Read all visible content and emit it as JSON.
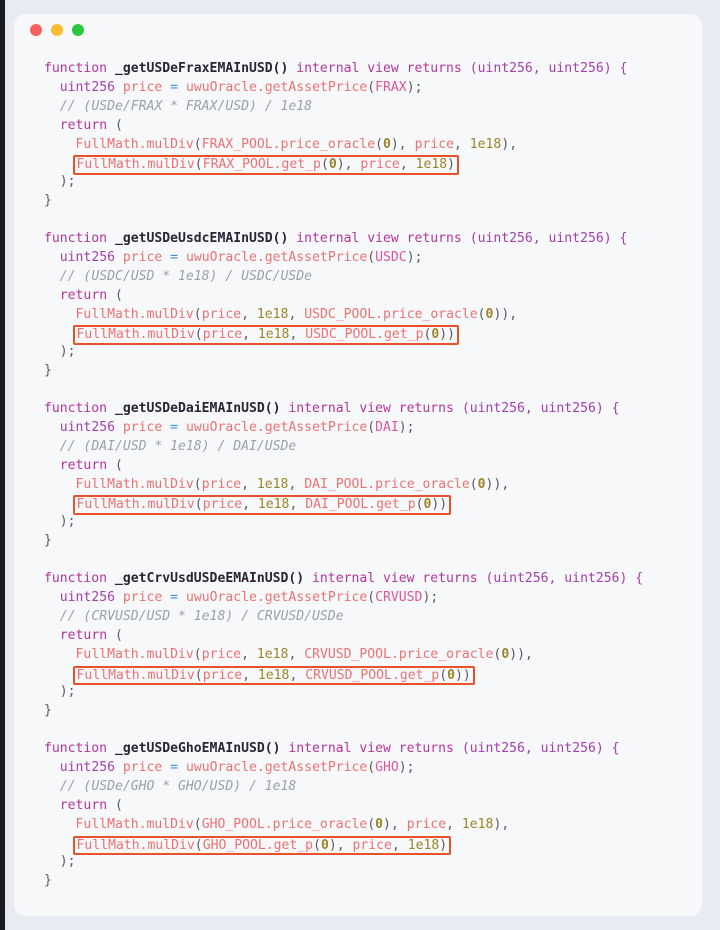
{
  "window": {
    "traffic_lights": [
      {
        "name": "close",
        "color": "#f9605a"
      },
      {
        "name": "minimize",
        "color": "#fbbc2e"
      },
      {
        "name": "maximize",
        "color": "#2ac840"
      }
    ],
    "background": "#f7f8fa",
    "page_background": "#e9ebf3"
  },
  "theme": {
    "keyword": "#b5359c",
    "type": "#a33fae",
    "function_name": "#2c2433",
    "identifier": "#ec7272",
    "constant": "#e0559b",
    "operator": "#3b8fe0",
    "number": "#9a8426",
    "punctuation": "#5a5a66",
    "comment": "#9aa0aa",
    "highlight_border": "#e8522b"
  },
  "code": {
    "language": "solidity",
    "blocks": [
      {
        "name": "frax",
        "signature_keyword": "function",
        "signature_name": " _getUSDeFraxEMAInUSD()",
        "signature_modifiers": " internal view returns ",
        "signature_returns": "(uint256, uint256) {",
        "decl_type": "uint256",
        "decl_var": " price",
        "decl_op": " = ",
        "decl_call": "uwuOracle.getAssetPrice",
        "decl_arg": "FRAX",
        "comment": "// (USDe/FRAX * FRAX/USD) / 1e18",
        "return_kw": "return",
        "line_a_call": "FullMath.mulDiv",
        "line_a_args": [
          "FRAX_POOL.price_oracle",
          "0",
          "price",
          "1e18"
        ],
        "line_b_call": "FullMath.mulDiv",
        "line_b_args": [
          "FRAX_POOL.get_p",
          "0",
          "price",
          "1e18"
        ],
        "arg_order": "pool_first"
      },
      {
        "name": "usdc",
        "signature_keyword": "function",
        "signature_name": " _getUSDeUsdcEMAInUSD()",
        "signature_modifiers": " internal view returns ",
        "signature_returns": "(uint256, uint256) {",
        "decl_type": "uint256",
        "decl_var": " price",
        "decl_op": " = ",
        "decl_call": "uwuOracle.getAssetPrice",
        "decl_arg": "USDC",
        "comment": "// (USDC/USD * 1e18) / USDC/USDe",
        "return_kw": "return",
        "line_a_call": "FullMath.mulDiv",
        "line_a_args": [
          "price",
          "1e18",
          "USDC_POOL.price_oracle",
          "0"
        ],
        "line_b_call": "FullMath.mulDiv",
        "line_b_args": [
          "price",
          "1e18",
          "USDC_POOL.get_p",
          "0"
        ],
        "arg_order": "price_first"
      },
      {
        "name": "dai",
        "signature_keyword": "function",
        "signature_name": " _getUSDeDaiEMAInUSD()",
        "signature_modifiers": " internal view returns ",
        "signature_returns": "(uint256, uint256) {",
        "decl_type": "uint256",
        "decl_var": " price",
        "decl_op": " = ",
        "decl_call": "uwuOracle.getAssetPrice",
        "decl_arg": "DAI",
        "comment": "// (DAI/USD * 1e18) / DAI/USDe",
        "return_kw": "return",
        "line_a_call": "FullMath.mulDiv",
        "line_a_args": [
          "price",
          "1e18",
          "DAI_POOL.price_oracle",
          "0"
        ],
        "line_b_call": "FullMath.mulDiv",
        "line_b_args": [
          "price",
          "1e18",
          "DAI_POOL.get_p",
          "0"
        ],
        "arg_order": "price_first"
      },
      {
        "name": "crvusd",
        "signature_keyword": "function",
        "signature_name": " _getCrvUsdUSDeEMAInUSD()",
        "signature_modifiers": " internal view returns ",
        "signature_returns": "(uint256, uint256) {",
        "decl_type": "uint256",
        "decl_var": " price",
        "decl_op": " = ",
        "decl_call": "uwuOracle.getAssetPrice",
        "decl_arg": "CRVUSD",
        "comment": "// (CRVUSD/USD * 1e18) / CRVUSD/USDe",
        "return_kw": "return",
        "line_a_call": "FullMath.mulDiv",
        "line_a_args": [
          "price",
          "1e18",
          "CRVUSD_POOL.price_oracle",
          "0"
        ],
        "line_b_call": "FullMath.mulDiv",
        "line_b_args": [
          "price",
          "1e18",
          "CRVUSD_POOL.get_p",
          "0"
        ],
        "arg_order": "price_first"
      },
      {
        "name": "gho",
        "signature_keyword": "function",
        "signature_name": " _getUSDeGhoEMAInUSD()",
        "signature_modifiers": " internal view returns ",
        "signature_returns": "(uint256, uint256) {",
        "decl_type": "uint256",
        "decl_var": " price",
        "decl_op": " = ",
        "decl_call": "uwuOracle.getAssetPrice",
        "decl_arg": "GHO",
        "comment": "// (USDe/GHO * GHO/USD) / 1e18",
        "return_kw": "return",
        "line_a_call": "FullMath.mulDiv",
        "line_a_args": [
          "GHO_POOL.price_oracle",
          "0",
          "price",
          "1e18"
        ],
        "line_b_call": "FullMath.mulDiv",
        "line_b_args": [
          "GHO_POOL.get_p",
          "0",
          "price",
          "1e18"
        ],
        "arg_order": "pool_first"
      }
    ],
    "tokens": {
      "open_paren": "(",
      "close_paren": ")",
      "comma_space": ", ",
      "semicolon": ";",
      "close_paren_semicolon": ");",
      "close_brace": "}",
      "indent1": "  ",
      "indent2": "    "
    }
  }
}
